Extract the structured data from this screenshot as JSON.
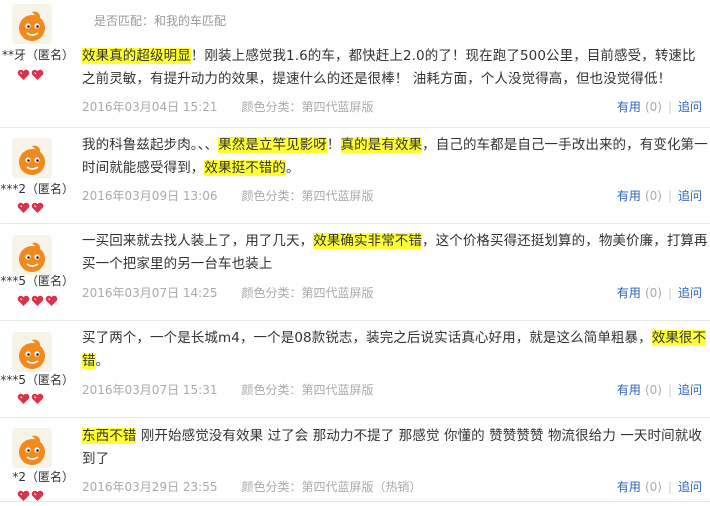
{
  "top_note": "是否匹配：和我的车匹配",
  "reviews": [
    {
      "username": "**牙（匿名）",
      "hearts": 2,
      "segments": [
        {
          "text": "效果真的超级明显",
          "hl": true
        },
        {
          "text": "！刚装上感觉我1.6的车，都快赶上2.0的了！现在跑了500公里，目前感受，转速比之前灵敏，有提升动力的效果，提速什么的还是很棒！ 油耗方面，个人没觉得高，但也没觉得低！",
          "hl": false
        }
      ],
      "date": "2016年03月04日 15:21",
      "color": "颜色分类：第四代蓝屏版",
      "useful_label": "有用",
      "useful_count": "(0)",
      "ask_label": "追问"
    },
    {
      "username": "***2（匿名）",
      "hearts": 2,
      "segments": [
        {
          "text": "我的科鲁兹起步肉。、、",
          "hl": false
        },
        {
          "text": "果然是立竿见影呀",
          "hl": true
        },
        {
          "text": "！",
          "hl": false
        },
        {
          "text": "真的是有效果",
          "hl": true
        },
        {
          "text": "，自己的车都是自己一手改出来的，有变化第一时间就能感受得到，",
          "hl": false
        },
        {
          "text": "效果挺不错的",
          "hl": true
        },
        {
          "text": "。",
          "hl": false
        }
      ],
      "date": "2016年03月09日 13:06",
      "color": "颜色分类：第四代蓝屏版",
      "useful_label": "有用",
      "useful_count": "(0)",
      "ask_label": "追问"
    },
    {
      "username": "***5（匿名）",
      "hearts": 3,
      "segments": [
        {
          "text": "一买回来就去找人装上了，用了几天，",
          "hl": false
        },
        {
          "text": "效果确实非常不错",
          "hl": true
        },
        {
          "text": "，这个价格买得还挺划算的，物美价廉，打算再买一个把家里的另一台车也装上",
          "hl": false
        }
      ],
      "date": "2016年03月07日 14:25",
      "color": "颜色分类：第四代蓝屏版",
      "useful_label": "有用",
      "useful_count": "(0)",
      "ask_label": "追问"
    },
    {
      "username": "***5（匿名）",
      "hearts": 2,
      "segments": [
        {
          "text": "买了两个，一个是长城m4，一个是08款锐志，装完之后说实话真心好用，就是这么简单粗暴，",
          "hl": false
        },
        {
          "text": "效果很不错",
          "hl": true
        },
        {
          "text": "。",
          "hl": false
        }
      ],
      "date": "2016年03月07日 15:31",
      "color": "颜色分类：第四代蓝屏版",
      "useful_label": "有用",
      "useful_count": "(0)",
      "ask_label": "追问"
    },
    {
      "username": "*2（匿名）",
      "hearts": 2,
      "segments": [
        {
          "text": "东西不错",
          "hl": true
        },
        {
          "text": " 刚开始感觉没有效果 过了会 那动力不提了 那感觉 你懂的 赞赞赞赞 物流很给力 一天时间就收到了",
          "hl": false
        }
      ],
      "date": "2016年03月29日 23:55",
      "color": "颜色分类：第四代蓝屏版（热销）",
      "useful_label": "有用",
      "useful_count": "(0)",
      "ask_label": "追问"
    }
  ],
  "colors": {
    "highlight": "#ffff33",
    "link": "#2a62b8",
    "meta": "#aaaaaa",
    "heart": "#d8334a"
  }
}
